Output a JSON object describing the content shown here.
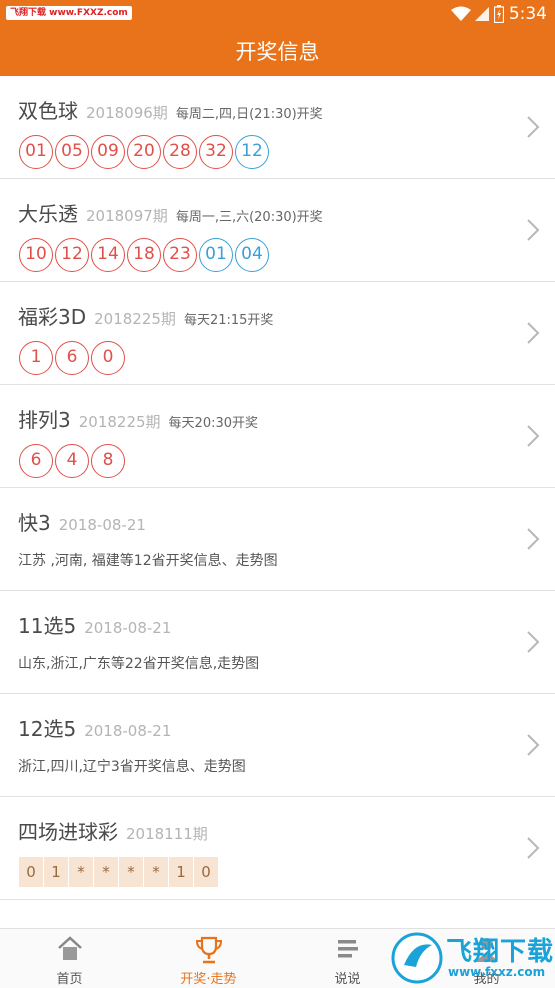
{
  "status_bar": {
    "watermark": "飞翔下载 www.FXXZ.com",
    "time": "5:34"
  },
  "header": {
    "title": "开奖信息"
  },
  "lotteries": [
    {
      "name": "双色球",
      "issue": "2018096期",
      "schedule": "每周二,四,日(21:30)开奖",
      "red_balls": [
        "01",
        "05",
        "09",
        "20",
        "28",
        "32"
      ],
      "blue_balls": [
        "12"
      ]
    },
    {
      "name": "大乐透",
      "issue": "2018097期",
      "schedule": "每周一,三,六(20:30)开奖",
      "red_balls": [
        "10",
        "12",
        "14",
        "18",
        "23"
      ],
      "blue_balls": [
        "01",
        "04"
      ]
    },
    {
      "name": "福彩3D",
      "issue": "2018225期",
      "schedule": "每天21:15开奖",
      "red_balls": [
        "1",
        "6",
        "0"
      ],
      "blue_balls": []
    },
    {
      "name": "排列3",
      "issue": "2018225期",
      "schedule": "每天20:30开奖",
      "red_balls": [
        "6",
        "4",
        "8"
      ],
      "blue_balls": []
    },
    {
      "name": "快3",
      "issue": "2018-08-21",
      "description": "江苏 ,河南, 福建等12省开奖信息、走势图"
    },
    {
      "name": "11选5",
      "issue": "2018-08-21",
      "description": "山东,浙江,广东等22省开奖信息,走势图"
    },
    {
      "name": "12选5",
      "issue": "2018-08-21",
      "description": "浙江,四川,辽宁3省开奖信息、走势图"
    },
    {
      "name": "四场进球彩",
      "issue": "2018111期",
      "cells": [
        "0",
        "1",
        "*",
        "*",
        "*",
        "*",
        "1",
        "0"
      ]
    }
  ],
  "tabs": [
    {
      "label": "首页",
      "icon": "home-icon",
      "active": false
    },
    {
      "label": "开奖·走势",
      "icon": "trophy-icon",
      "active": true
    },
    {
      "label": "说说",
      "icon": "list-icon",
      "active": false
    },
    {
      "label": "我的",
      "icon": "person-icon",
      "active": false
    }
  ],
  "overlay_watermark": {
    "title": "飞翔下载",
    "url": "www.fxxz.com"
  },
  "colors": {
    "brand_orange": "#e8731b",
    "red_ball": "#e0504a",
    "blue_ball": "#3aa0d6",
    "cell_bg": "#f7e4d3"
  }
}
